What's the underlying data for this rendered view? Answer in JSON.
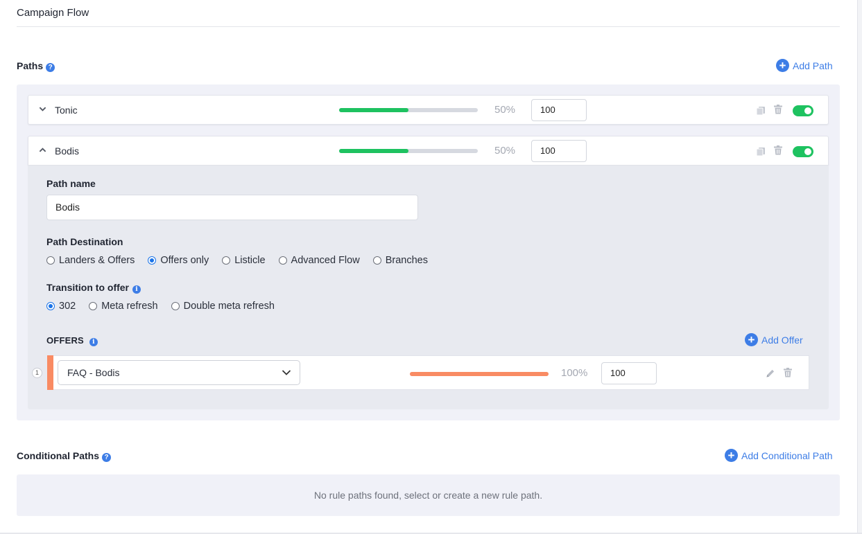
{
  "page": {
    "title": "Campaign Flow"
  },
  "paths": {
    "title": "Paths",
    "help_icon": "question-circle-icon",
    "add_label": "Add Path",
    "items": [
      {
        "name": "Tonic",
        "percent_label": "50%",
        "percent": 50,
        "weight": "100",
        "enabled": true,
        "expanded": false
      },
      {
        "name": "Bodis",
        "percent_label": "50%",
        "percent": 50,
        "weight": "100",
        "enabled": true,
        "expanded": true
      }
    ]
  },
  "path_editor": {
    "name_label": "Path name",
    "name_value": "Bodis",
    "destination_label": "Path Destination",
    "destination_options": [
      "Landers & Offers",
      "Offers only",
      "Listicle",
      "Advanced Flow",
      "Branches"
    ],
    "destination_selected": "Offers only",
    "transition_label": "Transition to offer",
    "transition_options": [
      "302",
      "Meta refresh",
      "Double meta refresh"
    ],
    "transition_selected": "302",
    "offers_title": "OFFERS",
    "add_offer_label": "Add Offer",
    "offers": [
      {
        "index": "1",
        "name": "FAQ - Bodis",
        "percent_label": "100%",
        "percent": 100,
        "weight": "100"
      }
    ]
  },
  "conditional_paths": {
    "title": "Conditional Paths",
    "add_label": "Add Conditional Path",
    "empty_message": "No rule paths found, select or create a new rule path."
  },
  "colors": {
    "accent": "#3d7de6",
    "path_progress": "#1ec260",
    "offer_progress": "#f98b63",
    "toggle_on": "#1ec260"
  }
}
